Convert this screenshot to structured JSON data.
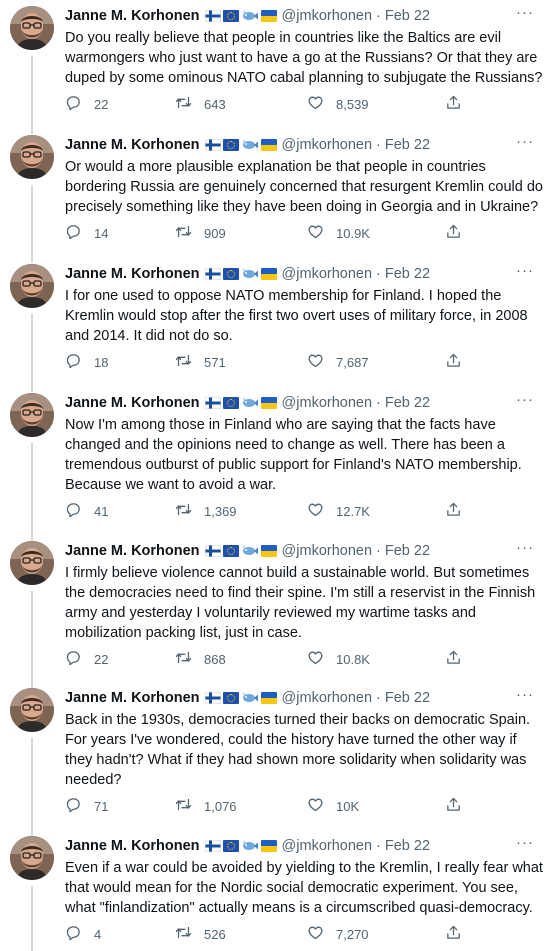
{
  "colors": {
    "text": "#0f1419",
    "secondary": "#536471",
    "thread_line": "#cfd9de"
  },
  "tweets": [
    {
      "name": "Janne M. Korhonen",
      "handle": "@jmkorhonen",
      "date": "Feb 22",
      "text": "Do you really believe that people in countries like the Baltics are evil warmongers who just want to have a go at the Russians? Or that they are duped by some ominous NATO cabal planning to subjugate the Russians?",
      "replies": "22",
      "retweets": "643",
      "likes": "8,539"
    },
    {
      "name": "Janne M. Korhonen",
      "handle": "@jmkorhonen",
      "date": "Feb 22",
      "text": "Or would a more plausible explanation be that people in countries bordering Russia are genuinely concerned that resurgent Kremlin could do precisely something like they have been doing in Georgia and in Ukraine?",
      "replies": "14",
      "retweets": "909",
      "likes": "10.9K"
    },
    {
      "name": "Janne M. Korhonen",
      "handle": "@jmkorhonen",
      "date": "Feb 22",
      "text": "I for one used to oppose NATO membership for Finland. I hoped the Kremlin would stop after the first two overt uses of military force, in 2008 and 2014. It did not do so.",
      "replies": "18",
      "retweets": "571",
      "likes": "7,687"
    },
    {
      "name": "Janne M. Korhonen",
      "handle": "@jmkorhonen",
      "date": "Feb 22",
      "text": "Now I'm among those in Finland who are saying that the facts have changed and the opinions need to change as well. There has been a tremendous outburst of public support for Finland's NATO membership. Because we want to avoid a war.",
      "replies": "41",
      "retweets": "1,369",
      "likes": "12.7K"
    },
    {
      "name": "Janne M. Korhonen",
      "handle": "@jmkorhonen",
      "date": "Feb 22",
      "text": "I firmly believe violence cannot build a sustainable world. But sometimes the democracies need to find their spine. I'm still a reservist in the Finnish army and yesterday I voluntarily reviewed my wartime tasks and mobilization packing list, just in case.",
      "replies": "22",
      "retweets": "868",
      "likes": "10.8K"
    },
    {
      "name": "Janne M. Korhonen",
      "handle": "@jmkorhonen",
      "date": "Feb 22",
      "text": "Back in the 1930s, democracies turned their backs on democratic Spain. For years I've wondered, could the history have turned the other way if they hadn't? What if they had shown more solidarity when solidarity was needed?",
      "replies": "71",
      "retweets": "1,076",
      "likes": "10K"
    },
    {
      "name": "Janne M. Korhonen",
      "handle": "@jmkorhonen",
      "date": "Feb 22",
      "text": "Even if a war could be avoided by yielding to the Kremlin, I really fear what that would mean for the Nordic social democratic experiment. You see, what \"finlandization\" actually means is a circumscribed quasi-democracy.",
      "replies": "4",
      "retweets": "526",
      "likes": "7,270"
    }
  ]
}
